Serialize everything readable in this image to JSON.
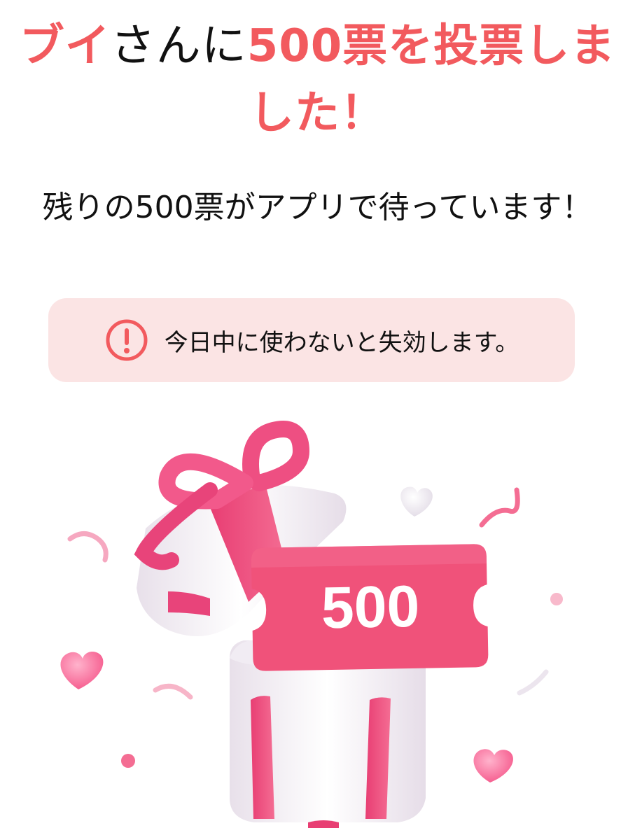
{
  "headline": {
    "name": "ブイ",
    "middle": "さんに",
    "votes": "500票を投票しました！"
  },
  "subtitle": "残りの500票がアプリで待っています！",
  "notice": {
    "icon": "alert-circle-icon",
    "text": "今日中に使わないと失効します。"
  },
  "ticket": {
    "value": "500"
  },
  "colors": {
    "accent": "#f25a5e",
    "ticket": "#f0527a",
    "notice_bg": "#fbe4e4"
  }
}
